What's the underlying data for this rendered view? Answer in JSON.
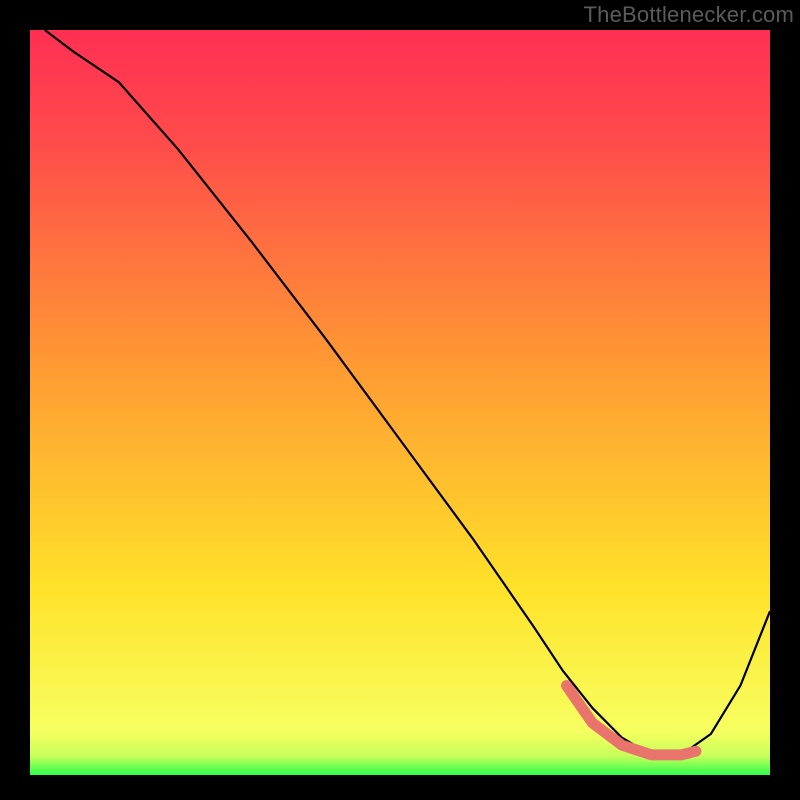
{
  "attribution": "TheBottlenecker.com",
  "chart_data": {
    "type": "line",
    "title": "",
    "xlabel": "",
    "ylabel": "",
    "xlim": [
      0,
      100
    ],
    "ylim": [
      0,
      100
    ],
    "grid": false,
    "series": [
      {
        "name": "bottleneck-curve",
        "color": "#000000",
        "x": [
          2,
          6,
          12,
          20,
          30,
          40,
          50,
          60,
          68,
          72,
          76,
          80,
          84,
          88,
          92,
          96,
          100
        ],
        "y": [
          100,
          97,
          93,
          84,
          71.5,
          58.5,
          45,
          31.5,
          20,
          14,
          9,
          5,
          2.7,
          2.7,
          5.5,
          12,
          22
        ]
      }
    ],
    "valley_highlight": {
      "color": "#e8746b",
      "x": [
        72.5,
        76,
        80,
        84,
        88,
        90
      ],
      "y": [
        12,
        7,
        4,
        2.7,
        2.7,
        3.2
      ]
    },
    "gradient_stops": [
      {
        "offset": 0,
        "color": "#ff2f53"
      },
      {
        "offset": 15,
        "color": "#ff4b4b"
      },
      {
        "offset": 45,
        "color": "#ff9a33"
      },
      {
        "offset": 75,
        "color": "#ffe229"
      },
      {
        "offset": 94,
        "color": "#f7ff60"
      },
      {
        "offset": 97.5,
        "color": "#c6ff5a"
      },
      {
        "offset": 100,
        "color": "#2dff4e"
      }
    ]
  }
}
